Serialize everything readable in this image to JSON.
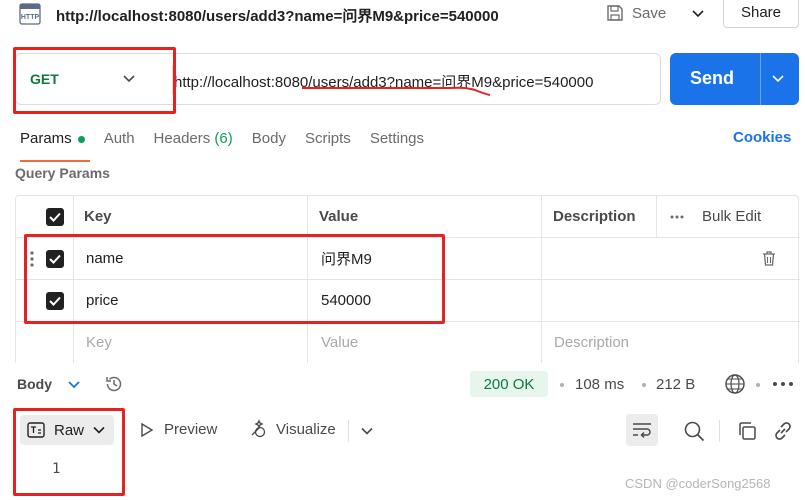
{
  "titlebar": {
    "method_badge": "HTTP",
    "url": "http://localhost:8080/users/add3?name=问界M9&price=540000",
    "save_label": "Save",
    "share_label": "Share"
  },
  "request": {
    "method": "GET",
    "url": "http://localhost:8080/users/add3?name=问界M9&price=540000",
    "send_label": "Send"
  },
  "tabs": [
    {
      "label": "Params",
      "active": true
    },
    {
      "label": "Auth"
    },
    {
      "label": "Headers",
      "count": "(6)"
    },
    {
      "label": "Body"
    },
    {
      "label": "Scripts"
    },
    {
      "label": "Settings"
    }
  ],
  "cookies_label": "Cookies",
  "query_params": {
    "title": "Query Params",
    "headers": {
      "key": "Key",
      "value": "Value",
      "description": "Description",
      "bulk_edit": "Bulk Edit"
    },
    "rows": [
      {
        "key": "name",
        "value": "问界M9",
        "checked": true
      },
      {
        "key": "price",
        "value": "540000",
        "checked": true
      }
    ],
    "placeholder": {
      "key": "Key",
      "value": "Value",
      "description": "Description"
    }
  },
  "response": {
    "body_label": "Body",
    "status": "200 OK",
    "time": "108 ms",
    "size": "212 B",
    "raw_label": "Raw",
    "preview_label": "Preview",
    "visualize_label": "Visualize",
    "line_number": "1"
  },
  "watermark": "CSDN @coderSong2568",
  "colors": {
    "accent": "#1a73e8",
    "success": "#0b7a3a",
    "annotation": "#e52222",
    "active_tab": "#f26b3a"
  }
}
